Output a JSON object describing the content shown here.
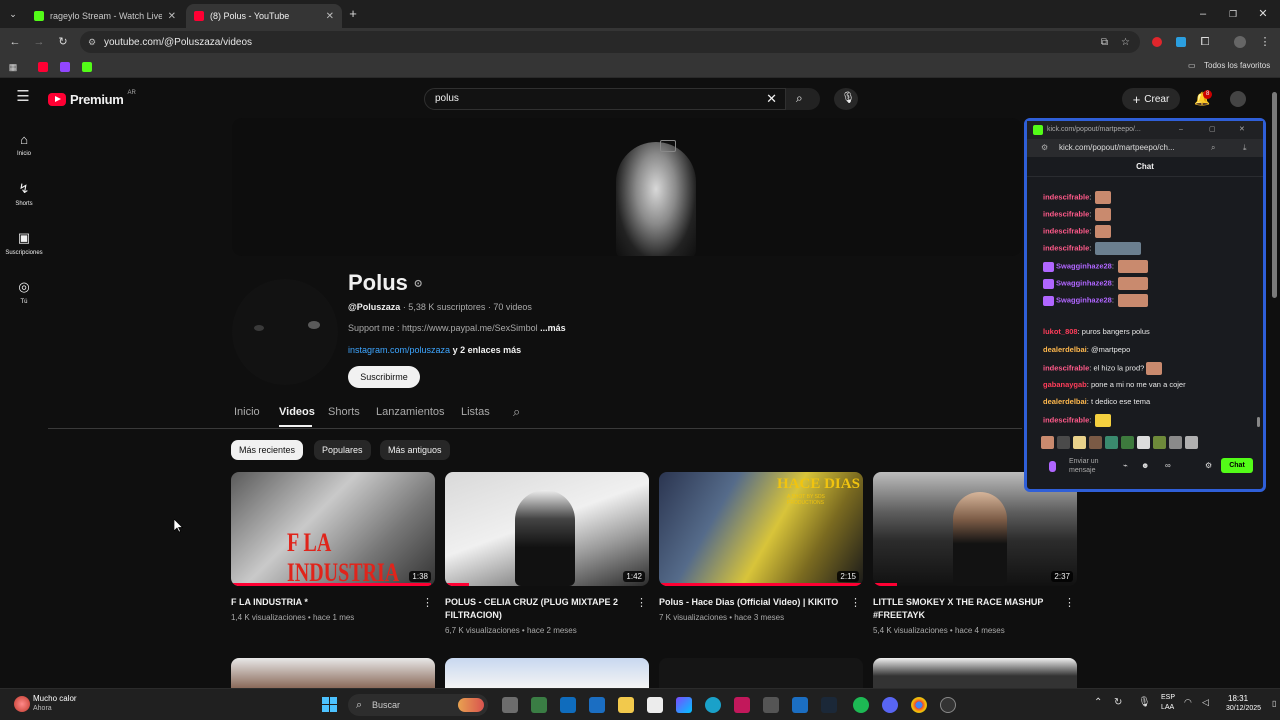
{
  "browser": {
    "tabs": [
      {
        "title": "rageylo Stream - Watch Live on",
        "active": false
      },
      {
        "title": "(8) Polus - YouTube",
        "active": true
      }
    ],
    "url": "youtube.com/@Poluszaza/videos",
    "bookmarks_label": "Todos los favoritos"
  },
  "youtube": {
    "logo": "Premium",
    "region": "AR",
    "search_value": "polus",
    "create_label": "Crear",
    "notif_count": "8",
    "sidebar": [
      {
        "label": "Inicio",
        "icon": "home-icon"
      },
      {
        "label": "Shorts",
        "icon": "shorts-icon"
      },
      {
        "label": "Suscripciones",
        "icon": "subscriptions-icon"
      },
      {
        "label": "Tú",
        "icon": "user-icon"
      }
    ],
    "channel": {
      "name": "Polus",
      "handle": "@Poluszaza",
      "subs": "· 5,38 K suscriptores · 70 videos",
      "description": "Support me : https://www.paypal.me/SexSimbol",
      "more": "...más",
      "link": "instagram.com/poluszaza",
      "more_links": "y 2 enlaces más",
      "subscribe": "Suscribirme"
    },
    "tabs": [
      "Inicio",
      "Videos",
      "Shorts",
      "Lanzamientos",
      "Listas"
    ],
    "chips": [
      "Más recientes",
      "Populares",
      "Más antiguos"
    ],
    "videos": [
      {
        "title": "F LA INDUSTRIA *",
        "meta": "1,4 K visualizaciones • hace 1 mes",
        "duration": "1:38",
        "thumb_text": "F LA INDUSTRIA",
        "watched": 0.98
      },
      {
        "title": "POLUS - CELIA CRUZ (PLUG MIXTAPE 2 FILTRACION)",
        "meta": "6,7 K visualizaciones • hace 2 meses",
        "duration": "1:42",
        "watched": 0.12
      },
      {
        "title": "Polus - Hace Dias (Official Video) | KIKITO",
        "meta": "7 K visualizaciones • hace 3 meses",
        "duration": "2:15",
        "thumb_text": "HACE DIAS",
        "thumb_sub": "A SHOT BY SDS PRODUCTIONS",
        "watched": 1.0
      },
      {
        "title": "LITTLE SMOKEY X THE RACE MASHUP #FREETAYK",
        "meta": "5,4 K visualizaciones • hace 4 meses",
        "duration": "2:37",
        "watched": 0.12
      }
    ]
  },
  "kick": {
    "window_title": "kick.com/popout/martpeepo/...",
    "url": "kick.com/popout/martpeepo/ch...",
    "chat_title": "Chat",
    "messages": [
      {
        "user": "indescifrable",
        "text": "",
        "color": "#ff5a8a"
      },
      {
        "user": "indescifrable",
        "text": "",
        "color": "#ff5a8a"
      },
      {
        "user": "indescifrable",
        "text": "",
        "color": "#ff5a8a"
      },
      {
        "user": "indescifrable",
        "text": "",
        "color": "#ff5a8a"
      },
      {
        "user": "Swagginhaze28",
        "text": "",
        "color": "#b066ff"
      },
      {
        "user": "Swagginhaze28",
        "text": "",
        "color": "#b066ff"
      },
      {
        "user": "Swagginhaze28",
        "text": "",
        "color": "#b066ff"
      },
      {
        "user": "lukot_808",
        "text": "puros bangers polus",
        "color": "#ff3d5a"
      },
      {
        "user": "dealerdelbai",
        "text": "@martpepo",
        "color": "#ffb84d"
      },
      {
        "user": "indescifrable",
        "text": "el hizo la prod?",
        "color": "#ff5a8a"
      },
      {
        "user": "gabanaygab",
        "text": "pone a mi no me van a cojer",
        "color": "#ff3d5a"
      },
      {
        "user": "dealerdelbai",
        "text": "t dedico ese tema",
        "color": "#ffb84d"
      },
      {
        "user": "indescifrable",
        "text": "",
        "color": "#ff5a8a"
      }
    ],
    "input_placeholder": "Enviar un mensaje",
    "send_label": "Chat",
    "accent": "#53fc18"
  },
  "taskbar": {
    "weather_title": "Mucho calor",
    "weather_sub": "Ahora",
    "search_label": "Buscar",
    "lang": "ESP",
    "lang_sub": "LAA",
    "time": "18:31",
    "date": "30/12/2025"
  }
}
